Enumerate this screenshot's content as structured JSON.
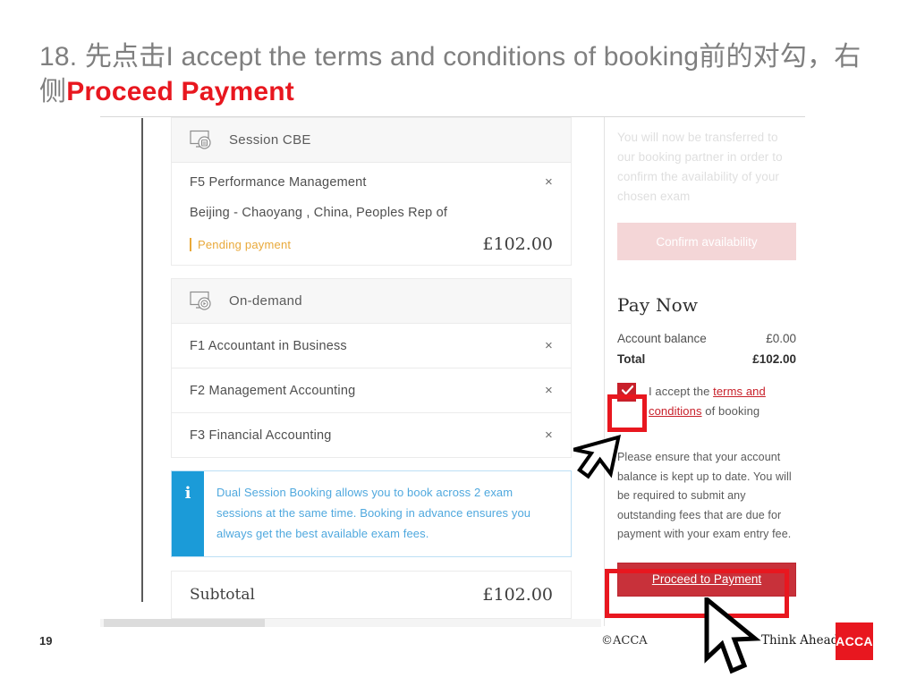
{
  "slide": {
    "heading_prefix": "18. 先点击I accept the terms and conditions of booking前的对勾，右侧",
    "heading_highlight": "Proceed Payment",
    "page_number": "19",
    "copyright": "©ACCA",
    "tagline": "Think Ahead",
    "logo_text": "ACCA",
    "accent_red": "#e8171f"
  },
  "cart": {
    "session_group": {
      "icon": "monitor-session-icon",
      "label": "Session CBE",
      "exam": {
        "name": "F5 Performance Management",
        "remove_label": "×",
        "venue": "Beijing - Chaoyang , China, Peoples Rep of",
        "status": "Pending payment",
        "price": "£102.00",
        "status_color": "#e9a93a"
      }
    },
    "ondemand_group": {
      "icon": "monitor-ondemand-icon",
      "label": "On-demand",
      "items": [
        {
          "name": "F1 Accountant in Business",
          "remove_label": "×"
        },
        {
          "name": "F2 Management Accounting",
          "remove_label": "×"
        },
        {
          "name": "F3 Financial Accounting",
          "remove_label": "×"
        }
      ]
    },
    "info_banner": {
      "icon": "info-icon",
      "text": "Dual Session Booking allows you to book across 2 exam sessions at the same time. Booking in advance ensures you always get the best available exam fees.",
      "bar_color": "#1b9bd8"
    },
    "subtotal": {
      "label": "Subtotal",
      "value": "£102.00"
    }
  },
  "side_panel": {
    "transfer_note": "You will now be transferred to our booking partner in order to confirm the availability of your chosen exam",
    "confirm_button": "Confirm availability",
    "pay_now_title": "Pay Now",
    "account_balance_label": "Account balance",
    "account_balance_value": "£0.00",
    "total_label": "Total",
    "total_value": "£102.00",
    "accept": {
      "checked": true,
      "prefix": "I accept the ",
      "link": "terms and conditions",
      "suffix": " of booking"
    },
    "note": "Please ensure that your account balance is kept up to date. You will be required to submit any outstanding fees that are due for payment with your exam entry fee.",
    "proceed_button": "Proceed to Payment",
    "button_color": "#c8313a"
  },
  "annotations": {
    "checkbox_highlight": "red-box-around-checkbox",
    "proceed_highlight": "red-box-around-proceed-button",
    "cursor_checkbox": "mouse-cursor",
    "cursor_proceed": "mouse-cursor"
  }
}
